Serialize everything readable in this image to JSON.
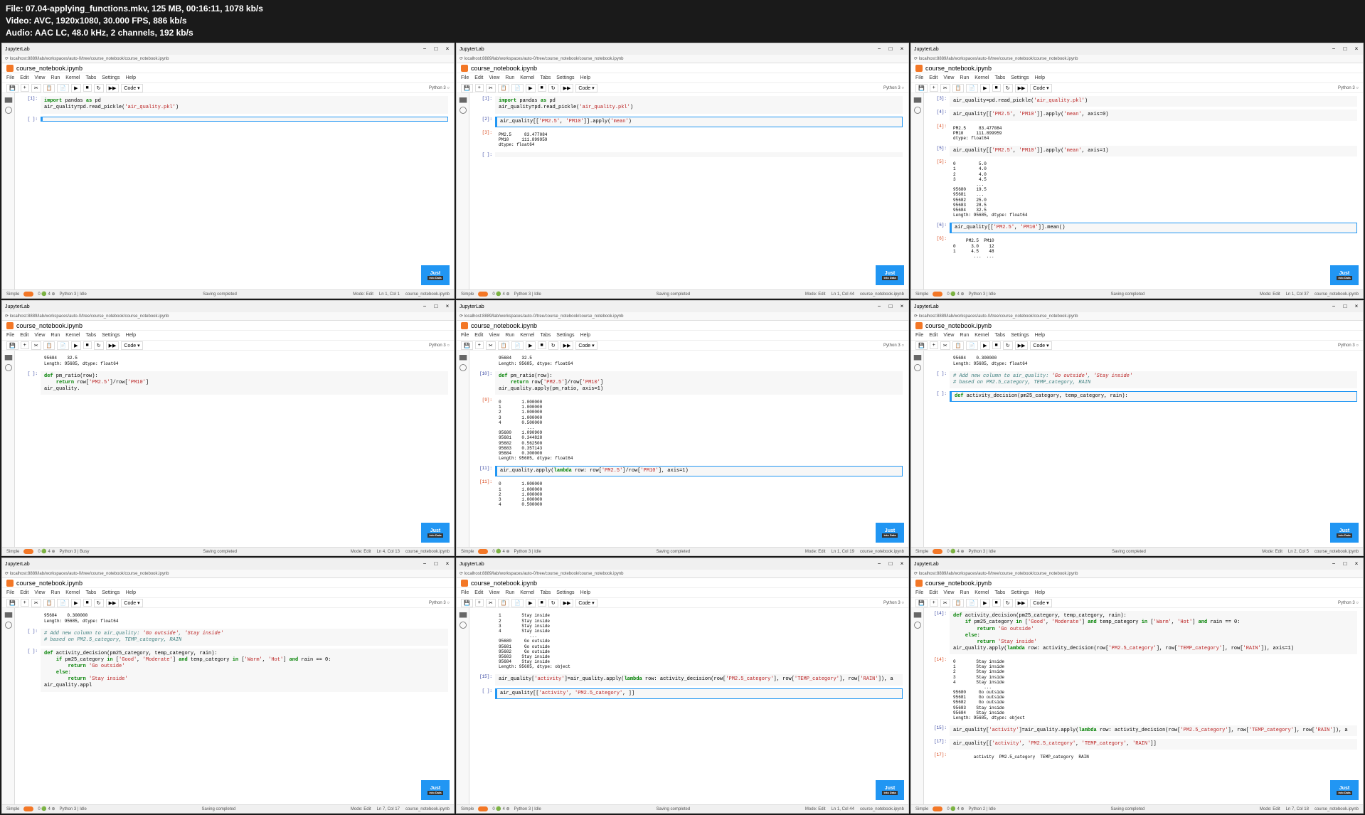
{
  "header": {
    "file_line": "File: 07.04-applying_functions.mkv, 125 MB, 00:16:11, 1078 kb/s",
    "video_line": "Video: AVC, 1920x1080, 30.000 FPS, 886 kb/s",
    "audio_line": "Audio: AAC LC, 48.0 kHz, 2 channels, 192 kb/s"
  },
  "common": {
    "app_title": "JupyterLab",
    "url": "localhost:8889/lab/workspaces/auto-0/tree/course_notebook/course_notebook.ipynb",
    "notebook_name": "course_notebook.ipynb",
    "menus": [
      "File",
      "Edit",
      "View",
      "Run",
      "Kernel",
      "Tabs",
      "Settings",
      "Help"
    ],
    "kernel": "Python 3",
    "toolbar_code": "Code",
    "status_simple": "Simple",
    "status_saving": "Saving completed",
    "status_mode": "Mode: Edit",
    "status_idle": "Idle",
    "status_busy": "Busy",
    "watermark_top": "Just",
    "watermark_bottom": "into Data"
  },
  "panels": [
    {
      "status_ln": "Ln 1, Col 1",
      "kernel_state": "Python 3 | Idle",
      "cells": [
        {
          "prompt": "[1]:",
          "type": "code",
          "lines": [
            "import pandas as pd",
            "air_quality=pd.read_pickle('air_quality.pkl')"
          ]
        },
        {
          "prompt": "[ ]:",
          "type": "code",
          "active": true,
          "lines": [
            ""
          ]
        }
      ]
    },
    {
      "status_ln": "Ln 1, Col 44",
      "kernel_state": "Python 3 | Idle",
      "cells": [
        {
          "prompt": "[1]:",
          "type": "code",
          "lines": [
            "import pandas as pd",
            "air_quality=pd.read_pickle('air_quality.pkl')"
          ]
        },
        {
          "prompt": "[2]:",
          "type": "code",
          "active": true,
          "lines": [
            "air_quality[['PM2.5', 'PM10']].apply('mean')"
          ]
        },
        {
          "prompt": "[3]:",
          "type": "output",
          "lines": [
            "PM2.5     83.477084",
            "PM10     111.899959",
            "dtype: float64"
          ]
        },
        {
          "prompt": "[ ]:",
          "type": "code",
          "lines": [
            ""
          ]
        }
      ]
    },
    {
      "status_ln": "Ln 1, Col 37",
      "kernel_state": "Python 3 | Idle",
      "cells": [
        {
          "prompt": "[3]:",
          "type": "code",
          "lines": [
            "air_quality=pd.read_pickle('air_quality.pkl')"
          ]
        },
        {
          "prompt": "[4]:",
          "type": "code",
          "lines": [
            "air_quality[['PM2.5', 'PM10']].apply('mean', axis=0)"
          ]
        },
        {
          "prompt": "[4]:",
          "type": "output",
          "lines": [
            "PM2.5     83.477084",
            "PM10     111.899959",
            "dtype: float64"
          ]
        },
        {
          "prompt": "[5]:",
          "type": "code",
          "lines": [
            "air_quality[['PM2.5', 'PM10']].apply('mean', axis=1)"
          ]
        },
        {
          "prompt": "[5]:",
          "type": "output",
          "lines": [
            "0         5.0",
            "1         4.0",
            "2         4.0",
            "3         4.5",
            "         ... ",
            "95680    19.5",
            "95681    ...",
            "95682    25.0",
            "95683    28.5",
            "95684    32.5",
            "Length: 95685, dtype: float64"
          ]
        },
        {
          "prompt": "[6]:",
          "type": "code",
          "active": true,
          "lines": [
            "air_quality[['PM2.5', 'PM10']].mean()"
          ]
        },
        {
          "prompt": "[6]:",
          "type": "output",
          "lines": [
            "     PM2.5  PM10",
            "0      3.0    12",
            "1      4.5    48",
            "        ...  ..."
          ]
        }
      ]
    },
    {
      "status_ln": "Ln 4, Col 13",
      "kernel_state": "Python 3 | Busy",
      "cells": [
        {
          "prompt": "",
          "type": "output",
          "lines": [
            "95684    32.5",
            "Length: 95685, dtype: float64"
          ]
        },
        {
          "prompt": "[ ]:",
          "type": "code",
          "lines": [
            "def pm_ratio(row):",
            "    return row['PM2.5']/row['PM10']",
            "",
            "air_quality."
          ]
        }
      ]
    },
    {
      "status_ln": "Ln 1, Col 19",
      "kernel_state": "Python 3 | Idle",
      "cells": [
        {
          "prompt": "",
          "type": "output",
          "lines": [
            "95684    32.5",
            "Length: 95685, dtype: float64"
          ]
        },
        {
          "prompt": "[10]:",
          "type": "code",
          "lines": [
            "def pm_ratio(row):",
            "    return row['PM2.5']/row['PM10']",
            "",
            "air_quality.apply(pm_ratio, axis=1)"
          ]
        },
        {
          "prompt": "[9]:",
          "type": "output",
          "lines": [
            "0        1.000000",
            "1        1.000000",
            "2        1.000000",
            "3        1.000000",
            "4        0.500000",
            "           ...   ",
            "95680    1.090909",
            "95681    0.344828",
            "95682    0.562500",
            "95683    0.357143",
            "95684    0.300000",
            "Length: 95685, dtype: float64"
          ]
        },
        {
          "prompt": "[11]:",
          "type": "code",
          "active": true,
          "lines": [
            "air_quality.apply(lambda row: row['PM2.5']/row['PM10'], axis=1)"
          ]
        },
        {
          "prompt": "[11]:",
          "type": "output",
          "lines": [
            "0        1.000000",
            "1        1.000000",
            "2        1.000000",
            "3        1.000000",
            "4        0.500000"
          ]
        }
      ]
    },
    {
      "status_ln": "Ln 2, Col 5",
      "kernel_state": "Python 3 | Idle",
      "cells": [
        {
          "prompt": "",
          "type": "output",
          "lines": [
            "95684    0.300000",
            "Length: 95685, dtype: float64"
          ]
        },
        {
          "prompt": "[ ]:",
          "type": "code",
          "lines": [
            "# Add new column to air_quality: 'Go outside', 'Stay inside'",
            "# based on PM2.5_category, TEMP_category, RAIN"
          ]
        },
        {
          "prompt": "[ ]:",
          "type": "code",
          "active": true,
          "lines": [
            "def activity_decision(pm25_category, temp_category, rain):"
          ]
        }
      ]
    },
    {
      "status_ln": "Ln 7, Col 17",
      "kernel_state": "Python 3 | Idle",
      "cells": [
        {
          "prompt": "",
          "type": "output",
          "lines": [
            "95684    0.300000",
            "Length: 95685, dtype: float64"
          ]
        },
        {
          "prompt": "[ ]:",
          "type": "code",
          "lines": [
            "# Add new column to air_quality: 'Go outside', 'Stay inside'",
            "# based on PM2.5_category, TEMP_category, RAIN"
          ]
        },
        {
          "prompt": "[ ]:",
          "type": "code",
          "lines": [
            "def activity_decision(pm25_category, temp_category, rain):",
            "    if pm25_category in ['Good', 'Moderate'] and temp_category in ['Warm', 'Hot'] and rain == 0:",
            "        return 'Go outside'",
            "    else:",
            "        return 'Stay inside'",
            "",
            "air_quality.appl"
          ]
        }
      ]
    },
    {
      "status_ln": "Ln 1, Col 44",
      "kernel_state": "Python 3 | Idle",
      "cells": [
        {
          "prompt": "",
          "type": "output",
          "lines": [
            "1        Stay inside",
            "2        Stay inside",
            "3        Stay inside",
            "4        Stay inside",
            "            ...     ",
            "95680     Go outside",
            "95681     Go outside",
            "95682     Go outside",
            "95683    Stay inside",
            "95684    Stay inside",
            "Length: 95685, dtype: object"
          ]
        },
        {
          "prompt": "[15]:",
          "type": "code",
          "lines": [
            "air_quality['activity']=air_quality.apply(lambda row: activity_decision(row['PM2.5_category'], row['TEMP_category'], row['RAIN']), a"
          ]
        },
        {
          "prompt": "[ ]:",
          "type": "code",
          "active": true,
          "lines": [
            "air_quality[['activity', 'PM2.5_category', ]]"
          ]
        }
      ]
    },
    {
      "status_ln": "Ln 7, Col 18",
      "kernel_state": "Python 2 | Idle",
      "cells": [
        {
          "prompt": "[14]:",
          "type": "code",
          "lines": [
            "def activity_decision(pm25_category, temp_category, rain):",
            "    if pm25_category in ['Good', 'Moderate'] and temp_category in ['Warm', 'Hot'] and rain == 0:",
            "        return 'Go outside'",
            "    else:",
            "        return 'Stay inside'",
            "",
            "air_quality.apply(lambda row: activity_decision(row['PM2.5_category'], row['TEMP_category'], row['RAIN']), axis=1)"
          ]
        },
        {
          "prompt": "[14]:",
          "type": "output",
          "lines": [
            "0        Stay inside",
            "1        Stay inside",
            "2        Stay inside",
            "3        Stay inside",
            "4        Stay inside",
            "            ...     ",
            "95680     Go outside",
            "95681     Go outside",
            "95682     Go outside",
            "95683    Stay inside",
            "95684    Stay inside",
            "Length: 95685, dtype: object"
          ]
        },
        {
          "prompt": "[15]:",
          "type": "code",
          "lines": [
            "air_quality['activity']=air_quality.apply(lambda row: activity_decision(row['PM2.5_category'], row['TEMP_category'], row['RAIN']), a"
          ]
        },
        {
          "prompt": "[17]:",
          "type": "code",
          "lines": [
            "air_quality[['activity', 'PM2.5_category', 'TEMP_category', 'RAIN']]"
          ]
        },
        {
          "prompt": "[17]:",
          "type": "output",
          "lines": [
            "        activity  PM2.5_category  TEMP_category  RAIN"
          ]
        }
      ]
    }
  ]
}
